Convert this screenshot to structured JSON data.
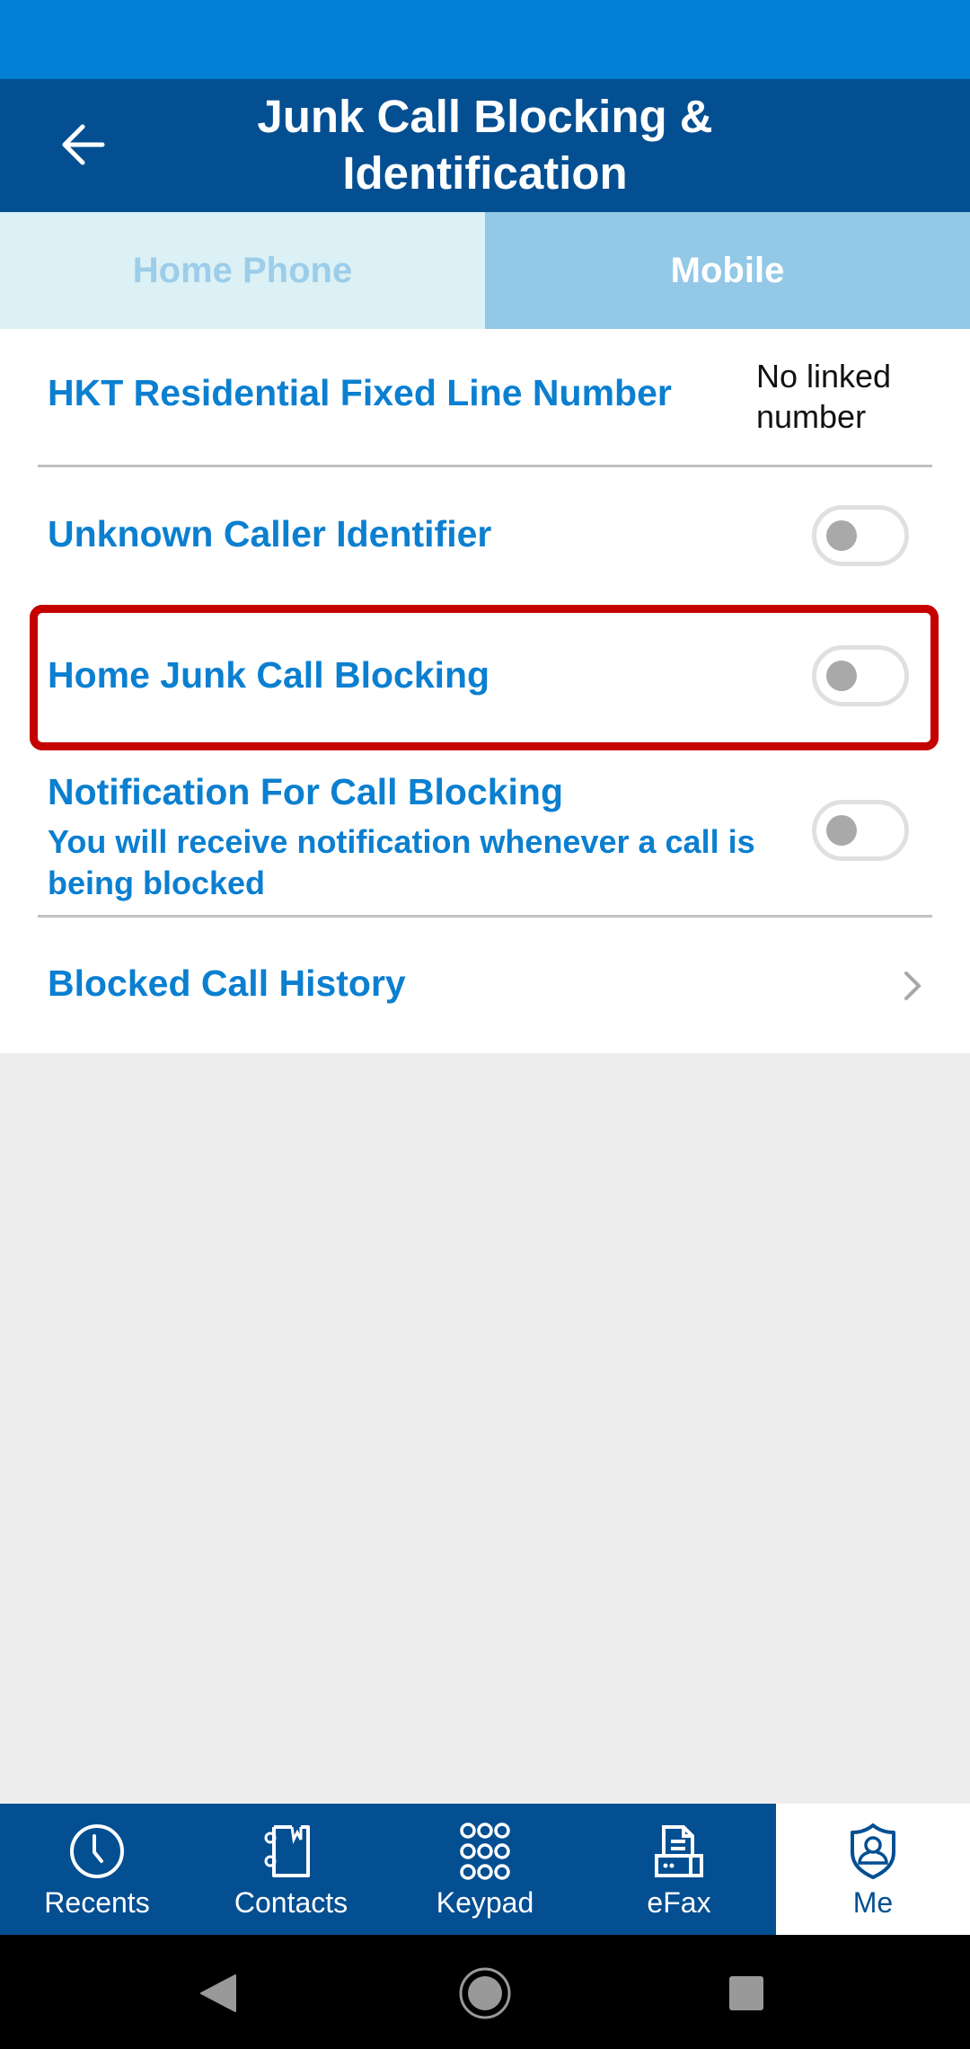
{
  "header": {
    "title": "Junk Call Blocking & Identification",
    "back_icon": "arrow-left-icon"
  },
  "tabs": [
    {
      "label": "Home Phone",
      "selected": false
    },
    {
      "label": "Mobile",
      "selected": true
    }
  ],
  "settings": {
    "fixed_line": {
      "label": "HKT Residential Fixed Line Number",
      "value": "No linked number"
    },
    "unknown_caller": {
      "label": "Unknown Caller Identifier",
      "enabled": false
    },
    "home_junk_blocking": {
      "label": "Home Junk Call Blocking",
      "enabled": false,
      "highlighted": true
    },
    "notification": {
      "label": "Notification For Call Blocking",
      "description": "You will receive notification whenever a call is being blocked",
      "enabled": false
    },
    "blocked_history": {
      "label": "Blocked Call History",
      "icon": "chevron-right-icon"
    }
  },
  "bottom_nav": [
    {
      "label": "Recents",
      "icon": "clock-icon",
      "active": false
    },
    {
      "label": "Contacts",
      "icon": "contacts-book-icon",
      "active": false
    },
    {
      "label": "Keypad",
      "icon": "keypad-icon",
      "active": false
    },
    {
      "label": "eFax",
      "icon": "fax-icon",
      "active": false
    },
    {
      "label": "Me",
      "icon": "shield-user-icon",
      "active": true
    }
  ],
  "system_nav": {
    "back": "back-triangle-icon",
    "home": "home-circle-icon",
    "recents": "recents-square-icon"
  },
  "colors": {
    "status_bar": "#0180d5",
    "header": "#044f92",
    "accent_text": "#0b7fd0",
    "highlight": "#c50000",
    "tab_inactive_bg": "#dcf1f5",
    "tab_active_bg": "#93c8e6"
  }
}
